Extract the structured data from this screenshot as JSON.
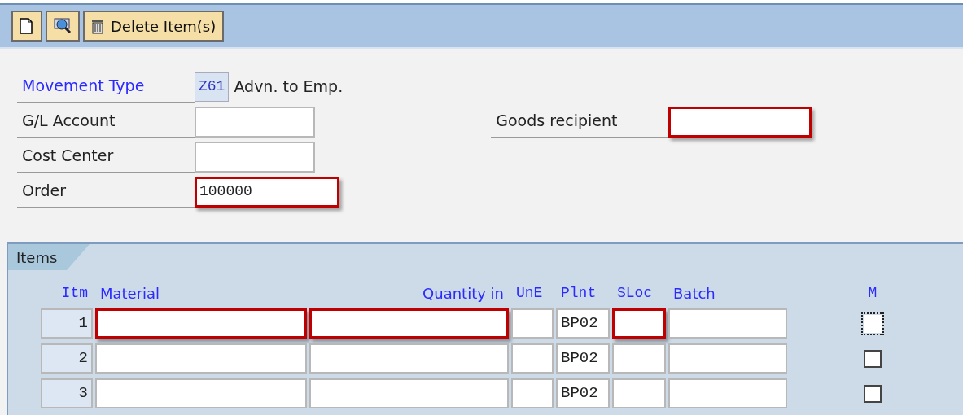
{
  "toolbar": {
    "buttons": [
      {
        "kind": "new"
      },
      {
        "kind": "find"
      },
      {
        "kind": "delete",
        "label": "Delete Item(s)"
      }
    ]
  },
  "header_fields": [
    {
      "label": "Movement Type",
      "label_link": true,
      "value": "Z61",
      "display_only": true,
      "description": "Advn. to Emp."
    },
    {
      "label": "G/L Account",
      "label_link": false,
      "display_only": false,
      "highlighted": false
    },
    {
      "label": "Cost Center",
      "label_link": false,
      "display_only": false,
      "highlighted": false
    },
    {
      "label": "Order",
      "label_link": false,
      "value": "100000",
      "display_only": false,
      "highlighted": true
    }
  ],
  "goods_recipient": {
    "label": "Goods recipient",
    "highlighted": true
  },
  "items": {
    "tab": "Items",
    "columns": [
      "Itm",
      "Material",
      "Quantity in",
      "UnE",
      "Plnt",
      "SLoc",
      "Batch",
      "M"
    ],
    "rows": [
      {
        "itm": "1",
        "plant": "BP02",
        "highlight_material": true,
        "highlight_quantity": true,
        "highlight_sloc": true,
        "marked": false,
        "focused": true
      },
      {
        "itm": "2",
        "plant": "BP02",
        "highlight_material": false,
        "highlight_quantity": false,
        "highlight_sloc": false,
        "marked": false,
        "focused": false
      },
      {
        "itm": "3",
        "plant": "BP02",
        "highlight_material": false,
        "highlight_quantity": false,
        "highlight_sloc": false,
        "marked": false,
        "focused": false
      }
    ]
  }
}
